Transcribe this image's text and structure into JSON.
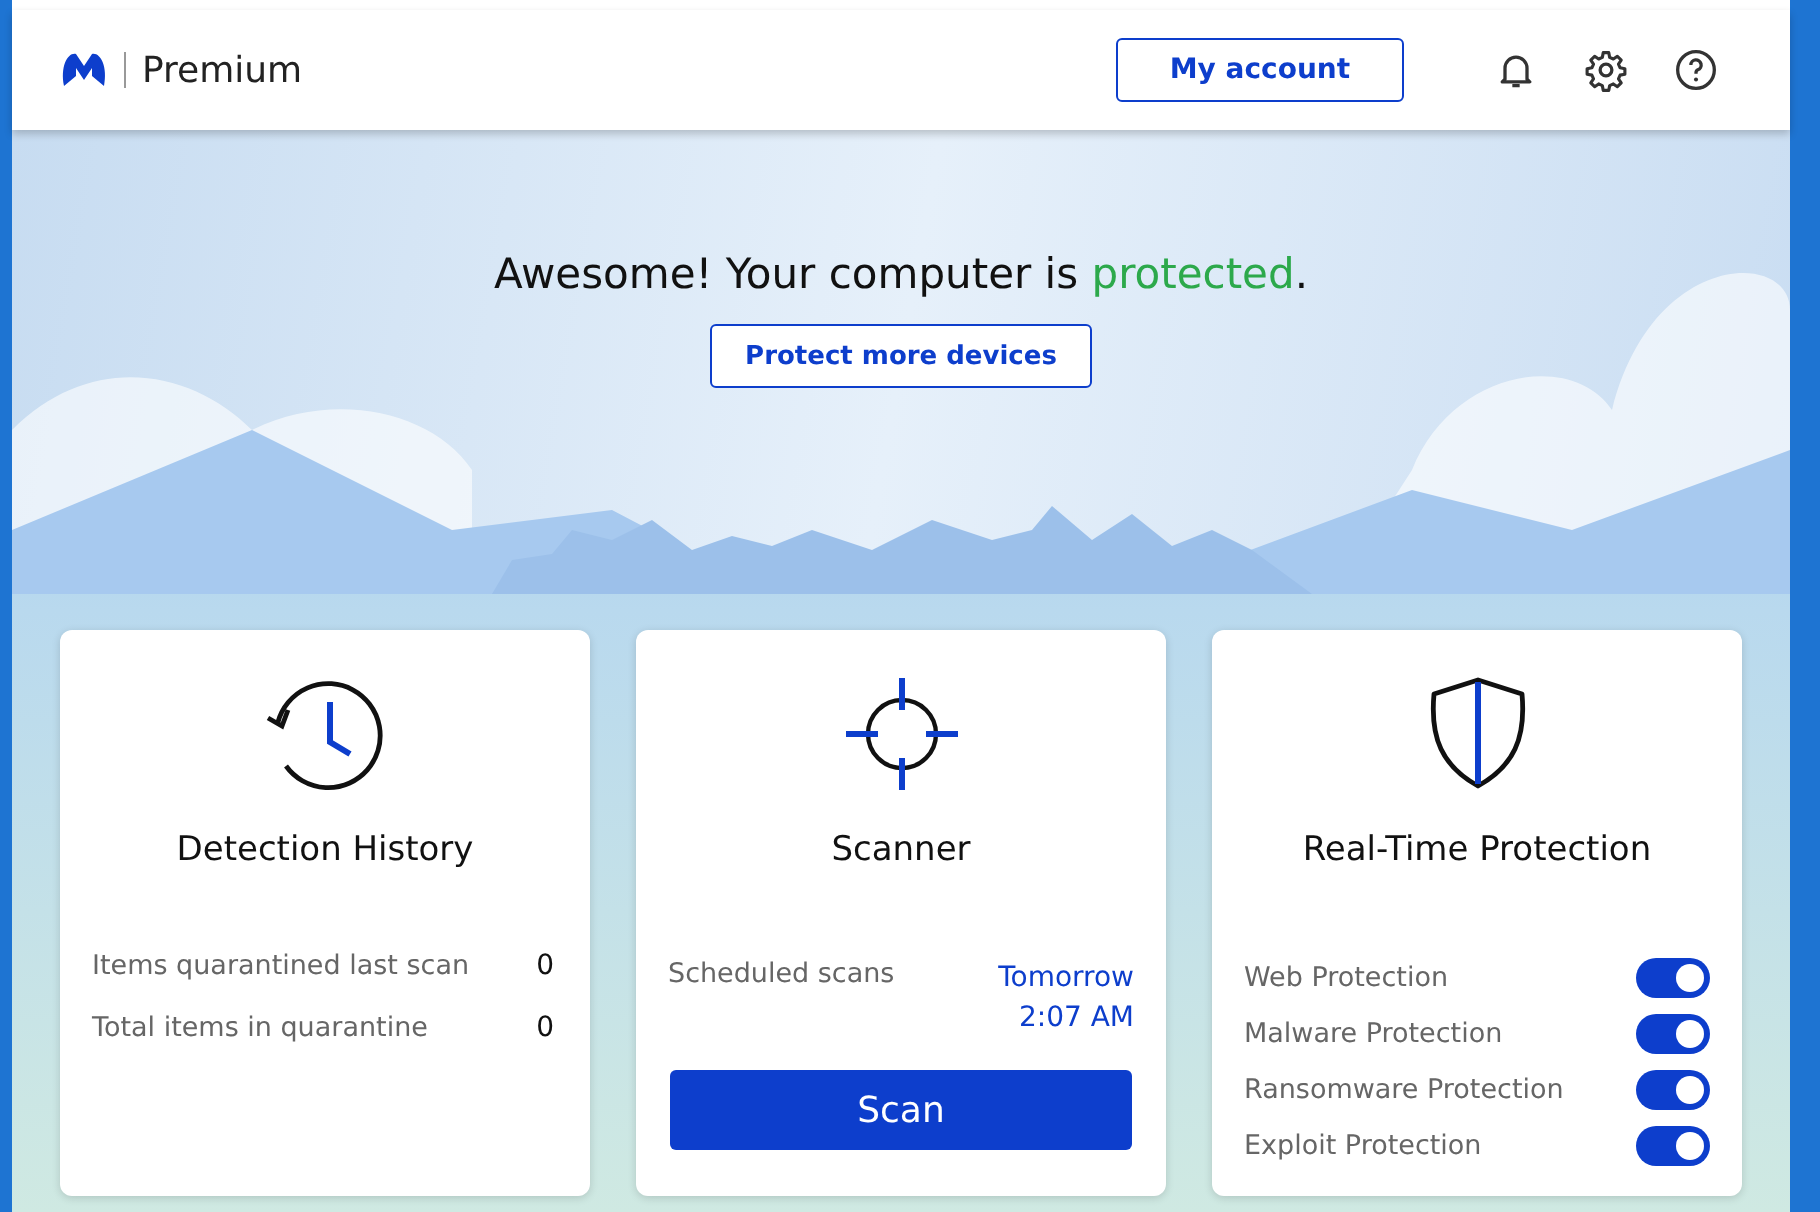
{
  "header": {
    "product": "Premium",
    "account_button": "My account"
  },
  "hero": {
    "headline": {
      "before": "Awesome! Your computer is ",
      "status": "protected",
      "after": "."
    },
    "button": "Protect more devices"
  },
  "cards": [
    {
      "kind": "history",
      "title": "Detection History",
      "rows": [
        {
          "label": "Items quarantined last scan",
          "value": "0"
        },
        {
          "label": "Total items in quarantine",
          "value": "0"
        }
      ]
    },
    {
      "kind": "scanner",
      "title": "Scanner",
      "schedule_label": "Scheduled scans",
      "schedule_value": [
        "Tomorrow",
        "2:07 AM"
      ],
      "button": "Scan"
    },
    {
      "kind": "protection",
      "title": "Real-Time Protection",
      "toggles": [
        {
          "label": "Web Protection",
          "on": true
        },
        {
          "label": "Malware Protection",
          "on": true
        },
        {
          "label": "Ransomware Protection",
          "on": true
        },
        {
          "label": "Exploit Protection",
          "on": true
        }
      ]
    }
  ]
}
